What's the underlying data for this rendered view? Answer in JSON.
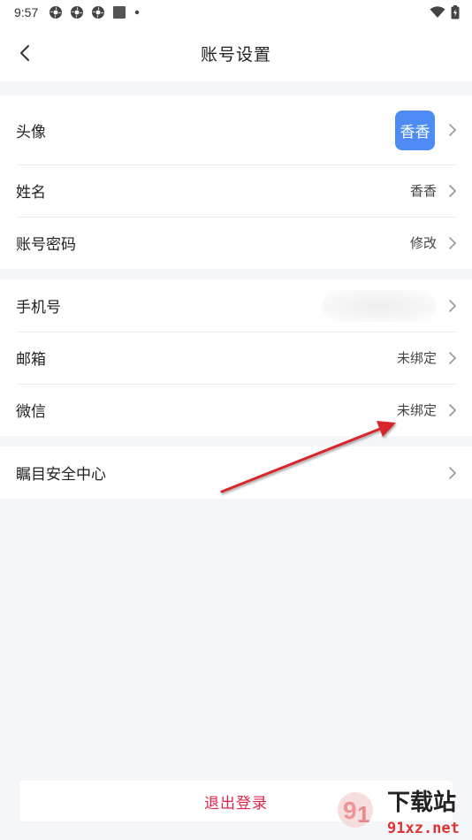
{
  "status_bar": {
    "time": "9:57",
    "icons": [
      "notification-icon",
      "notification-icon",
      "notification-icon",
      "notification-square-icon",
      "dot-icon"
    ],
    "right_icons": [
      "wifi-icon",
      "battery-icon"
    ]
  },
  "nav": {
    "title": "账号设置",
    "back_icon": "chevron-left-icon"
  },
  "sections": {
    "profile": {
      "avatar_label": "头像",
      "avatar_text": "香香",
      "name_label": "姓名",
      "name_value": "香香",
      "password_label": "账号密码",
      "password_value": "修改"
    },
    "bindings": {
      "phone_label": "手机号",
      "email_label": "邮箱",
      "email_value": "未绑定",
      "wechat_label": "微信",
      "wechat_value": "未绑定"
    },
    "security": {
      "label": "瞩目安全中心"
    }
  },
  "logout": {
    "label": "退出登录"
  },
  "colors": {
    "accent_blue": "#4e8cf5",
    "danger_red": "#e0244a",
    "background": "#f5f6f9",
    "annotation_arrow": "#d8262a"
  },
  "watermark": {
    "text": "下载站",
    "domain": "91xz.net"
  }
}
